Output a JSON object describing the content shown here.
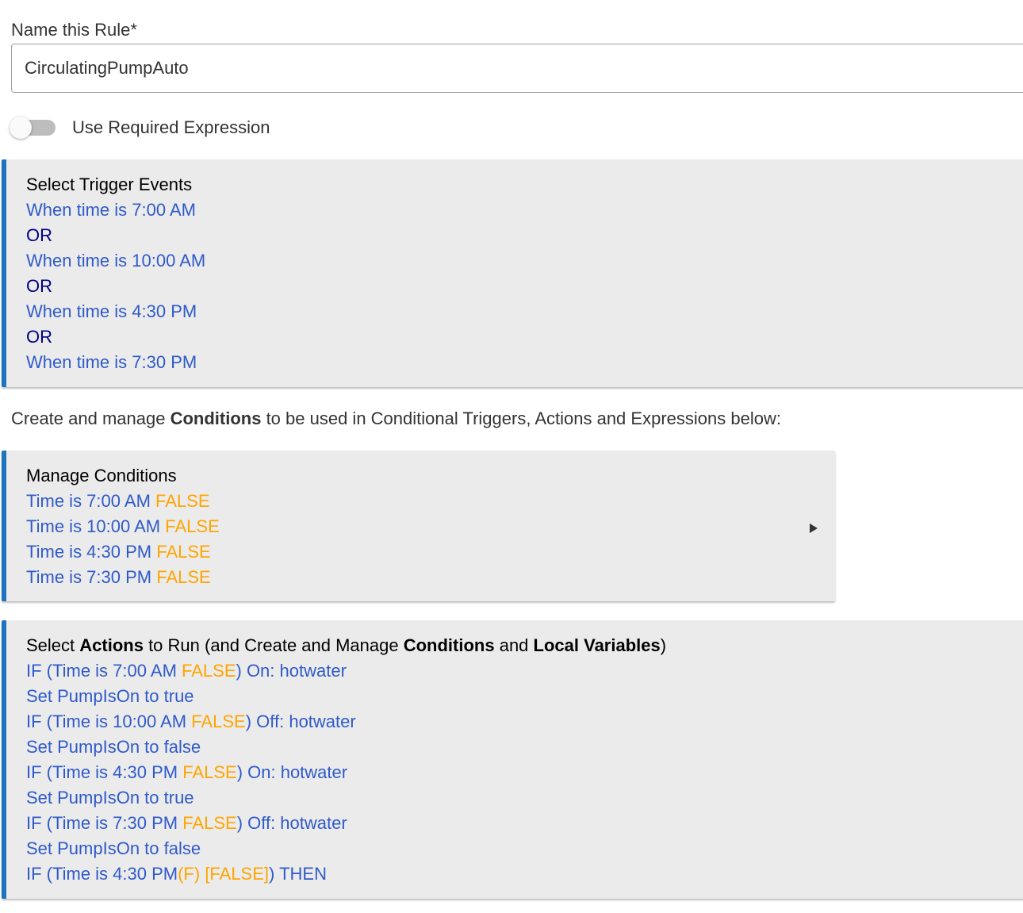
{
  "rule_name": {
    "label": "Name this Rule*",
    "value": "CirculatingPumpAuto"
  },
  "required_expression": {
    "label": "Use Required Expression",
    "enabled": false
  },
  "trigger_events": {
    "title": "Select Trigger Events",
    "lines": [
      "When time is 7:00 AM",
      "OR",
      "When time is 10:00 AM",
      "OR",
      "When time is 4:30 PM",
      "OR",
      "When time is 7:30 PM"
    ]
  },
  "conditions_description": {
    "prefix": "Create and manage ",
    "bold": "Conditions",
    "suffix": " to be used in Conditional Triggers, Actions and Expressions below:"
  },
  "manage_conditions": {
    "title": "Manage Conditions",
    "items": [
      {
        "text": "Time is 7:00 AM",
        "state": "FALSE"
      },
      {
        "text": "Time is 10:00 AM",
        "state": "FALSE"
      },
      {
        "text": "Time is 4:30 PM",
        "state": "FALSE"
      },
      {
        "text": "Time is 7:30 PM",
        "state": "FALSE"
      }
    ]
  },
  "actions": {
    "title": {
      "t1": "Select ",
      "b1": "Actions",
      "t2": " to Run (and Create and Manage ",
      "b2": "Conditions",
      "t3": " and ",
      "b3": "Local Variables",
      "t4": ")"
    },
    "lines": [
      {
        "a": "IF (Time is 7:00 AM ",
        "b": "FALSE",
        "c": ") On: hotwater"
      },
      {
        "a": "Set PumpIsOn to true"
      },
      {
        "a": "IF (Time is 10:00 AM ",
        "b": "FALSE",
        "c": ") Off: hotwater"
      },
      {
        "a": "Set PumpIsOn to false"
      },
      {
        "a": "IF (Time is 4:30 PM ",
        "b": "FALSE",
        "c": ") On: hotwater"
      },
      {
        "a": "Set PumpIsOn to true"
      },
      {
        "a": "IF (Time is 7:30 PM ",
        "b": "FALSE",
        "c": ") Off: hotwater"
      },
      {
        "a": "Set PumpIsOn to false"
      },
      {
        "a": "IF (Time is 4:30 PM",
        "b": "(F) [FALSE]",
        "c": ") THEN"
      }
    ]
  },
  "colors": {
    "accent_bar": "#1e73be",
    "link_blue": "#2f5ac9",
    "or_navy": "#000080",
    "false_orange": "#ffa500",
    "panel_bg": "#ebebeb"
  }
}
